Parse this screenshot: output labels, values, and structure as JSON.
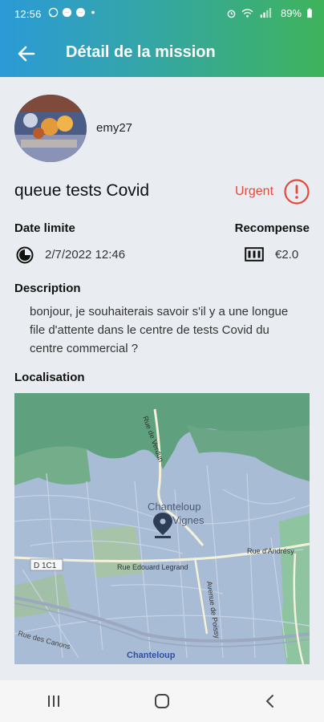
{
  "status_bar": {
    "time": "12:56",
    "battery": "89%",
    "left_icons": [
      "whatsapp-icon",
      "messenger-icon",
      "messenger-icon",
      "dot-icon"
    ],
    "right_icons": [
      "alarm-icon",
      "wifi-icon",
      "signal-icon",
      "battery-icon"
    ]
  },
  "header": {
    "title": "Détail de la mission",
    "back_icon": "arrow-left-icon",
    "gradient": [
      "#2b9ad7",
      "#3fb35b"
    ]
  },
  "user": {
    "username": "emy27"
  },
  "mission": {
    "title": "queue tests Covid",
    "priority": "Urgent",
    "priority_color": "#e24a3a",
    "deadline_label": "Date limite",
    "deadline_value": "2/7/2022 12:46",
    "reward_label": "Recompense",
    "reward_value": "€2.0",
    "description_label": "Description",
    "description": "bonjour, je souhaiterais savoir s'il y a une longue file d'attente dans le centre de tests Covid du centre commercial ?",
    "location_label": "Localisation"
  },
  "map": {
    "labels": {
      "town": "Chanteloup",
      "town2": "les-Vignes",
      "road1": "D 1C1",
      "road2": "Rue Edouard Legrand",
      "road3": "Rue d'Andrésy",
      "road4": "Avenue de Poissy",
      "road5": "Rue de Verdun",
      "road6": "Rue des Canons",
      "station": "Chanteloup"
    }
  },
  "nav": {
    "buttons": [
      "recent-apps-icon",
      "home-icon",
      "back-icon"
    ]
  }
}
